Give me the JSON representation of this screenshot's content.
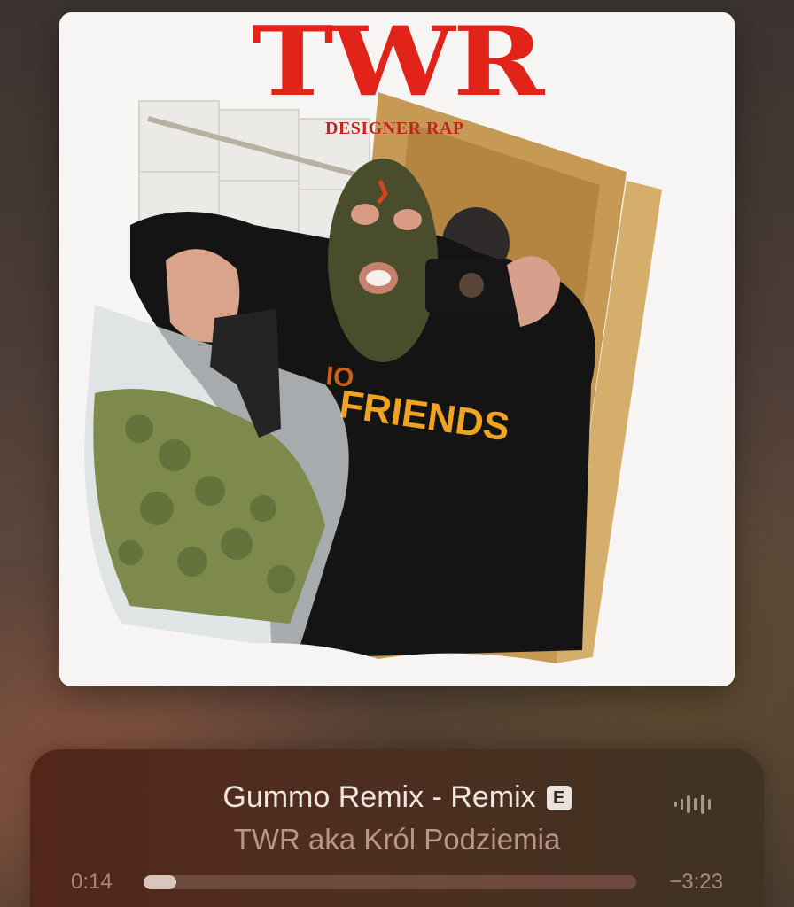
{
  "album_art": {
    "title": "TWR",
    "subtitle": "DESIGNER RAP",
    "hoodie_text": "FRIENDS"
  },
  "now_playing": {
    "song_title": "Gummo Remix - Remix",
    "explicit_badge": "E",
    "artist": "TWR aka Król Podziemia",
    "elapsed": "0:14",
    "remaining": "−3:23",
    "progress_fraction": 0.067
  },
  "icons": {
    "explicit": "explicit-badge-icon",
    "audio_waveform": "audio-waveform-icon"
  },
  "colors": {
    "art_title_red": "#e2231a",
    "player_bg": "#52271a",
    "track_fill": "#d8c6bd",
    "track_bg": "#6f4a3e"
  }
}
